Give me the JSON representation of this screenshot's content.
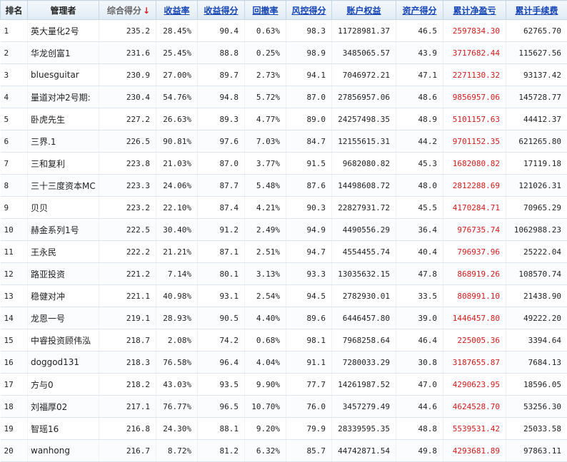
{
  "headers": {
    "rank": "排名",
    "manager": "管理者",
    "composite_score": "综合得分",
    "sort_arrow": "↓",
    "return_rate": "收益率",
    "return_score": "收益得分",
    "drawdown": "回撤率",
    "risk_score": "风控得分",
    "equity": "账户权益",
    "asset_score": "资产得分",
    "net_profit": "累计净盈亏",
    "fees": "累计手续费"
  },
  "colors": {
    "header_link": "#1544b5",
    "profit": "#d31a1a",
    "sort_arrow": "#d82020"
  },
  "rows": [
    [
      "1",
      "英大量化2号",
      "235.2",
      "28.45%",
      "90.4",
      "0.63%",
      "98.3",
      "11728981.37",
      "46.5",
      "2597834.30",
      "62765.70"
    ],
    [
      "2",
      "华龙创富1",
      "231.6",
      "25.45%",
      "88.8",
      "0.25%",
      "98.9",
      "3485065.57",
      "43.9",
      "3717682.44",
      "115627.56"
    ],
    [
      "3",
      "bluesguitar",
      "230.9",
      "27.00%",
      "89.7",
      "2.73%",
      "94.1",
      "7046972.21",
      "47.1",
      "2271130.32",
      "93137.42"
    ],
    [
      "4",
      "量道对冲2号期:",
      "230.4",
      "54.76%",
      "94.8",
      "5.72%",
      "87.0",
      "27856957.06",
      "48.6",
      "9856957.06",
      "145728.77"
    ],
    [
      "5",
      "卧虎先生",
      "227.2",
      "26.63%",
      "89.3",
      "4.77%",
      "89.0",
      "24257498.35",
      "48.9",
      "5101157.63",
      "44412.37"
    ],
    [
      "6",
      "三界.1",
      "226.5",
      "90.81%",
      "97.6",
      "7.03%",
      "84.7",
      "12155615.31",
      "44.2",
      "9701152.35",
      "621265.80"
    ],
    [
      "7",
      "三和复利",
      "223.8",
      "21.03%",
      "87.0",
      "3.77%",
      "91.5",
      "9682080.82",
      "45.3",
      "1682080.82",
      "17119.18"
    ],
    [
      "8",
      "三十三度资本MC",
      "223.3",
      "24.06%",
      "87.7",
      "5.48%",
      "87.6",
      "14498608.72",
      "48.0",
      "2812288.69",
      "121026.31"
    ],
    [
      "9",
      "贝贝",
      "223.2",
      "22.10%",
      "87.4",
      "4.21%",
      "90.3",
      "22827931.72",
      "45.5",
      "4170284.71",
      "70965.29"
    ],
    [
      "10",
      "赫金系列1号",
      "222.5",
      "30.40%",
      "91.2",
      "2.49%",
      "94.9",
      "4490556.29",
      "36.4",
      "976735.74",
      "1062988.23"
    ],
    [
      "11",
      "王永民",
      "222.2",
      "21.21%",
      "87.1",
      "2.51%",
      "94.7",
      "4554455.74",
      "40.4",
      "796937.96",
      "25222.04"
    ],
    [
      "12",
      "路亚投资",
      "221.2",
      "7.14%",
      "80.1",
      "3.13%",
      "93.3",
      "13035632.15",
      "47.8",
      "868919.26",
      "108570.74"
    ],
    [
      "13",
      "稳健对冲",
      "221.1",
      "40.98%",
      "93.1",
      "2.54%",
      "94.5",
      "2782930.01",
      "33.5",
      "808991.10",
      "21438.90"
    ],
    [
      "14",
      "龙恩一号",
      "219.1",
      "28.93%",
      "90.5",
      "4.40%",
      "89.6",
      "6446457.80",
      "39.0",
      "1446457.80",
      "49222.20"
    ],
    [
      "15",
      "中睿投资顾伟泓",
      "218.7",
      "2.08%",
      "74.2",
      "0.68%",
      "98.1",
      "7968258.64",
      "46.4",
      "225005.36",
      "3394.64"
    ],
    [
      "16",
      "doggod131",
      "218.3",
      "76.58%",
      "96.4",
      "4.04%",
      "91.1",
      "7280033.29",
      "30.8",
      "3187655.87",
      "7684.13"
    ],
    [
      "17",
      "方与0",
      "218.2",
      "43.03%",
      "93.5",
      "9.90%",
      "77.7",
      "14261987.52",
      "47.0",
      "4290623.95",
      "18596.05"
    ],
    [
      "18",
      "刘福厚02",
      "217.1",
      "76.77%",
      "96.5",
      "10.70%",
      "76.0",
      "3457279.49",
      "44.6",
      "4624528.70",
      "53256.30"
    ],
    [
      "19",
      "智瑶16",
      "216.8",
      "24.30%",
      "88.1",
      "9.20%",
      "79.9",
      "28339595.35",
      "48.8",
      "5539531.42",
      "25033.58"
    ],
    [
      "20",
      "wanhong",
      "216.7",
      "8.72%",
      "81.2",
      "6.32%",
      "85.7",
      "44742871.54",
      "49.8",
      "4293681.89",
      "97863.11"
    ]
  ]
}
